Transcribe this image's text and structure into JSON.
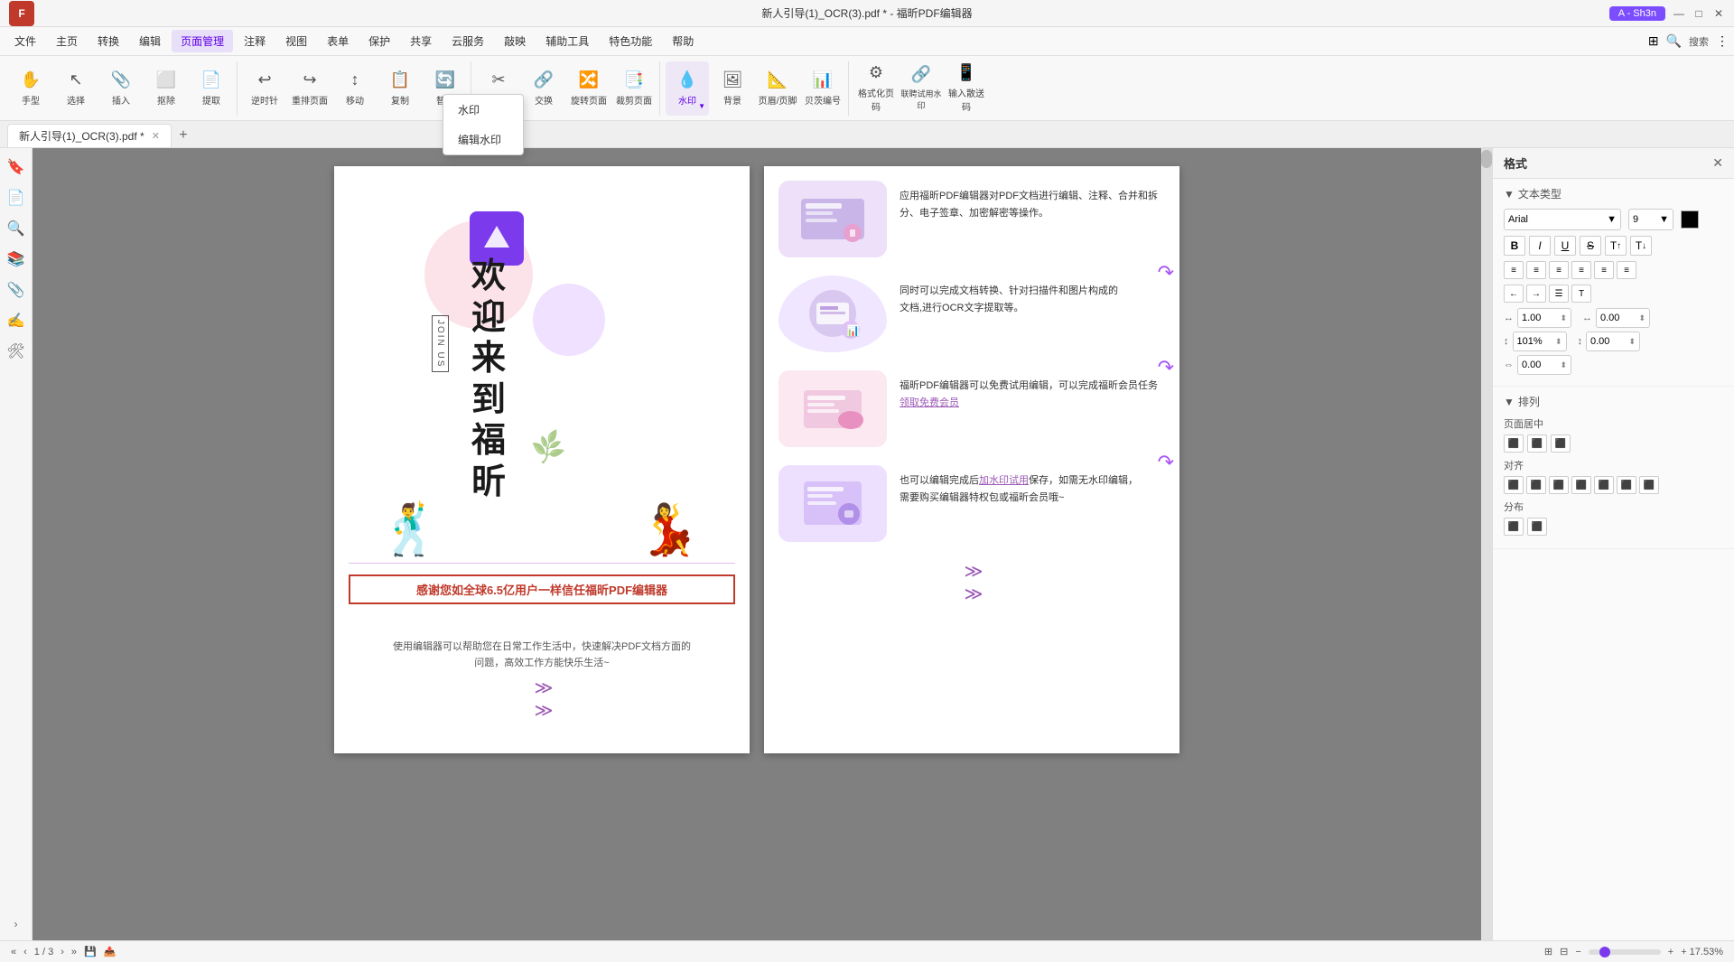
{
  "titlebar": {
    "title": "新人引导(1)_OCR(3).pdf * - 福昕PDF编辑器",
    "user_label": "A - Sh3n",
    "minimize": "—",
    "maximize": "□",
    "close": "✕"
  },
  "menubar": {
    "items": [
      {
        "label": "文件",
        "active": false
      },
      {
        "label": "主页",
        "active": false
      },
      {
        "label": "转换",
        "active": false
      },
      {
        "label": "编辑",
        "active": false
      },
      {
        "label": "页面管理",
        "active": true
      },
      {
        "label": "注释",
        "active": false
      },
      {
        "label": "视图",
        "active": false
      },
      {
        "label": "表单",
        "active": false
      },
      {
        "label": "保护",
        "active": false
      },
      {
        "label": "共享",
        "active": false
      },
      {
        "label": "云服务",
        "active": false
      },
      {
        "label": "敲映",
        "active": false
      },
      {
        "label": "辅助工具",
        "active": false
      },
      {
        "label": "特色功能",
        "active": false
      },
      {
        "label": "帮助",
        "active": false
      }
    ]
  },
  "toolbar": {
    "groups": [
      {
        "items": [
          {
            "icon": "✋",
            "label": "手型"
          },
          {
            "icon": "↖",
            "label": "选择"
          },
          {
            "icon": "📎",
            "label": "插入"
          },
          {
            "icon": "⬜",
            "label": "抠除"
          },
          {
            "icon": "📄",
            "label": "提取"
          }
        ]
      },
      {
        "items": [
          {
            "icon": "↩",
            "label": "逆时针旋转"
          },
          {
            "icon": "↪",
            "label": "重排页面"
          },
          {
            "icon": "↕",
            "label": "移动"
          },
          {
            "icon": "📋",
            "label": "复制"
          },
          {
            "icon": "🔄",
            "label": "替换"
          }
        ]
      },
      {
        "items": [
          {
            "icon": "✂",
            "label": "拆分"
          },
          {
            "icon": "🔗",
            "label": "交换"
          },
          {
            "icon": "🔀",
            "label": "旋转页面"
          },
          {
            "icon": "📑",
            "label": "裁剪页面"
          }
        ]
      },
      {
        "items": [
          {
            "icon": "💧",
            "label": "水印",
            "active": true
          },
          {
            "icon": "🖼",
            "label": "背景"
          },
          {
            "icon": "📐",
            "label": "页眉/页脚"
          },
          {
            "icon": "📊",
            "label": "贝茨编号"
          }
        ]
      },
      {
        "items": [
          {
            "icon": "⚙",
            "label": "格式化页码"
          },
          {
            "icon": "🔗",
            "label": "联聘试用水印"
          },
          {
            "icon": "📱",
            "label": "输入散送码"
          }
        ]
      }
    ],
    "watermark_dropdown": {
      "items": [
        {
          "label": "水印"
        },
        {
          "label": "编辑水印"
        }
      ]
    }
  },
  "tabs": {
    "active_tab": "新人引导(1)_OCR(3).pdf *",
    "add_label": "+"
  },
  "sidebar": {
    "icons": [
      {
        "name": "bookmark-icon",
        "symbol": "🔖"
      },
      {
        "name": "page-icon",
        "symbol": "📄"
      },
      {
        "name": "search-icon",
        "symbol": "🔍"
      },
      {
        "name": "layers-icon",
        "symbol": "📚"
      },
      {
        "name": "attachment-icon",
        "symbol": "📎"
      },
      {
        "name": "signature-icon",
        "symbol": "✍"
      },
      {
        "name": "tools-icon",
        "symbol": "🛠"
      },
      {
        "name": "expand-icon",
        "symbol": "›"
      }
    ]
  },
  "pdf": {
    "left_page": {
      "welcome_text": "欢迎来到福昕",
      "join_us": "JOIN US",
      "thankyou_text": "感谢您如全球6.5亿用户一样信任福昕PDF编辑器",
      "desc_text": "使用编辑器可以帮助您在日常工作生活中，快速解决PDF文档方面的\n问题，高效工作方能快乐生活~",
      "arrows": "≫",
      "arrows2": "≫"
    },
    "right_page": {
      "features": [
        {
          "text": "应用福昕PDF编辑器对PDF文档进行编辑、注释、合并和拆分、电子签章、加密解密等操作。"
        },
        {
          "text": "同时可以完成文档转换、针对扫描件和图片构成的\n文档,进行OCR文字提取等。"
        },
        {
          "text": "福昕PDF编辑器可以免费试用编辑，可以完成福昕会员任务领取免费会员",
          "link": "领取免费会员"
        },
        {
          "text": "也可以编辑完成后加水印试用保存，如需无水印编辑，\n需要购买编辑器特权包或福昕会员哦~",
          "link": "加水印试用"
        }
      ]
    }
  },
  "right_panel": {
    "title": "格式",
    "sections": {
      "text_type": {
        "title": "文本类型",
        "font": "Arial",
        "size": "9",
        "bold": "B",
        "italic": "I",
        "underline": "U",
        "strikethrough": "S",
        "superscript": "T",
        "subscript": "T"
      },
      "alignment": {
        "left": "≡",
        "center": "≡",
        "right": "≡",
        "justify": "≡",
        "more1": "≡",
        "more2": "≡"
      },
      "indent": {
        "decrease": "←",
        "increase": "→",
        "list": "≡",
        "more": "T"
      },
      "spacing": {
        "left_val": "1.00",
        "right_val": "0.00",
        "top_val": "101%",
        "bottom_val": "0.00",
        "extra_val": "0.00"
      },
      "layout": {
        "title": "排列",
        "page_center_label": "页面居中",
        "align_label": "对齐",
        "distribute_label": "分布"
      }
    }
  },
  "statusbar": {
    "page_info": "1 / 3",
    "nav_prev": "‹",
    "nav_next": "›",
    "nav_first": "«",
    "nav_last": "»",
    "save_icon": "💾",
    "share_icon": "📤",
    "view_icons": "⊞",
    "zoom_out": "−",
    "zoom_in": "+",
    "zoom_level": "+ 17.53%"
  }
}
